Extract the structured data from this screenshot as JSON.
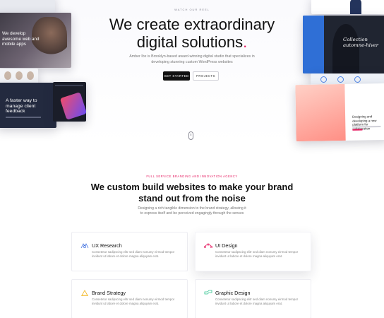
{
  "hero": {
    "eyebrow": "Watch our reel",
    "title_line1": "We create extraordinary",
    "title_line2": "digital solutions",
    "title_dot": ".",
    "description": "Amber Ibx is Brooklyn-based award-winning digital studio that specializes in developing stunning custom WordPress websites",
    "primary_button": "Get started",
    "secondary_button": "Projects"
  },
  "mockups": {
    "shot_b_text": "We develop awesome web and mobile apps",
    "shot_d_text": "A faster way to manage client feedback",
    "shot_g_title": "Collection automne-hiver",
    "shot_i_title": "Designing and developing a new platform for collaboration"
  },
  "services": {
    "eyebrow": "Full service branding and innovation agency",
    "title_line1": "We custom build websites to make your brand",
    "title_line2": "stand out from the noise",
    "description": "Designing a rich tangible dimension to the brand strategy, allowing it to express itself and be perceived engagingly through the senses",
    "cards": [
      {
        "title": "UX Research",
        "text": "Consetetur sadipscing elitr sed diam nonumy eirmod tempor invidunt ut labore et dolore magna aliquyam erat.",
        "icon": "ux-research-icon"
      },
      {
        "title": "UI Design",
        "text": "Consetetur sadipscing elitr sed diam nonumy eirmod tempor invidunt ut labore et dolore magna aliquyam erat.",
        "icon": "ui-design-icon"
      },
      {
        "title": "Brand Strategy",
        "text": "Consetetur sadipscing elitr sed diam nonumy eirmod tempor invidunt ut labore et dolore magna aliquyam erat.",
        "icon": "brand-strategy-icon"
      },
      {
        "title": "Graphic Design",
        "text": "Consetetur sadipscing elitr sed diam nonumy eirmod tempor invidunt ut labore et dolore magna aliquyam erat.",
        "icon": "graphic-design-icon"
      }
    ]
  },
  "colors": {
    "accent": "#e5195f",
    "dark": "#111111",
    "icon_blue": "#3e6fe0",
    "icon_pink": "#e5195f",
    "icon_yellow": "#f2b51d",
    "icon_green": "#2cc38f"
  }
}
